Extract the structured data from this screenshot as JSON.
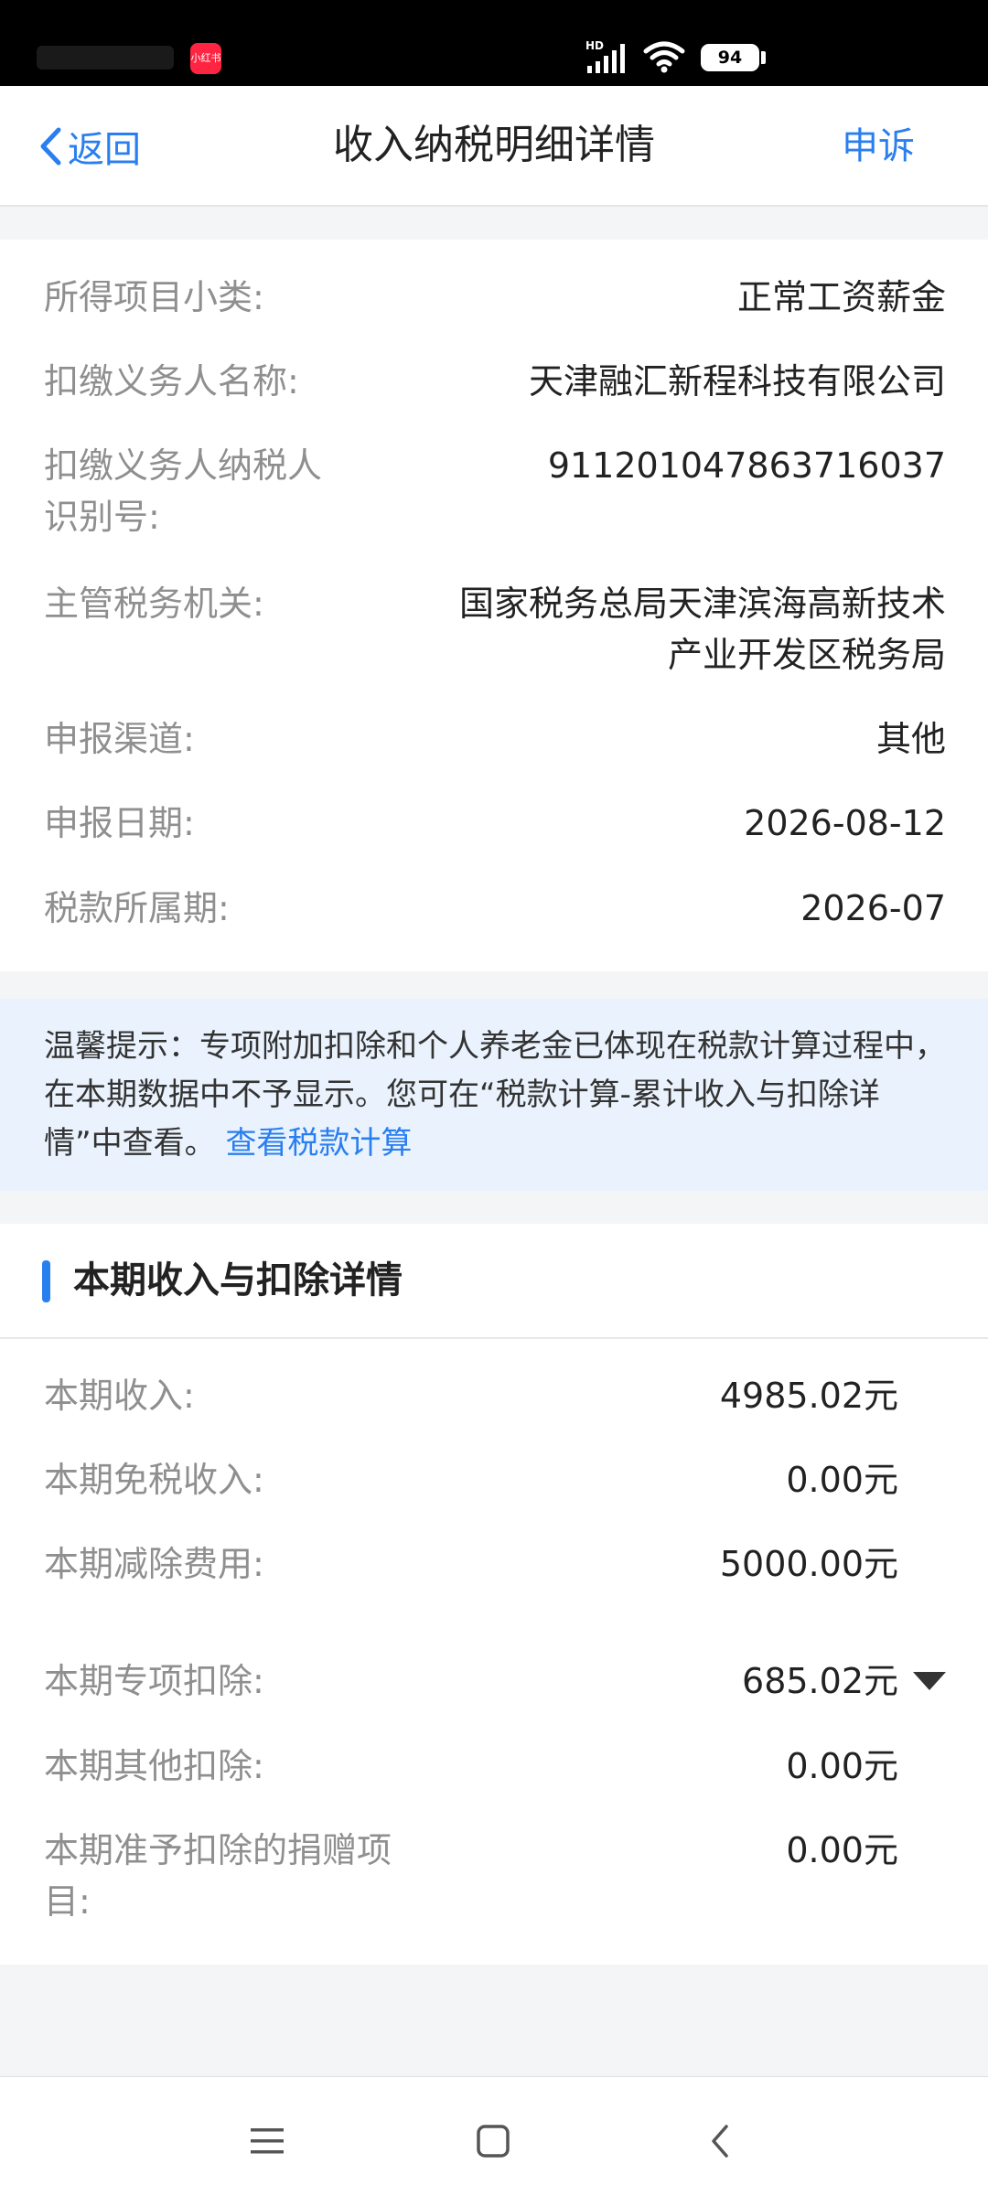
{
  "status_bar": {
    "app_badge": "小红书",
    "network": "HD",
    "battery": "94"
  },
  "header": {
    "back_label": "返回",
    "title": "收入纳税明细详情",
    "appeal_label": "申诉"
  },
  "details": [
    {
      "label": "所得项目小类:",
      "value": "正常工资薪金"
    },
    {
      "label": "扣缴义务人名称:",
      "value": "天津融汇新程科技有限公司"
    },
    {
      "label": "扣缴义务人纳税人",
      "label2": "识别号:",
      "value": "911201047863716037"
    },
    {
      "label": "主管税务机关:",
      "value": "国家税务总局天津滨海高新技术",
      "value2": "产业开发区税务局"
    },
    {
      "label": "申报渠道:",
      "value": "其他"
    },
    {
      "label": "申报日期:",
      "value": "2026-08-12"
    },
    {
      "label": "税款所属期:",
      "value": "2026-07"
    }
  ],
  "tip": {
    "text": "温馨提示：专项附加扣除和个人养老金已体现在税款计算过程中，在本期数据中不予显示。您可在“税款计算-累计收入与扣除详情”中查看。",
    "link": "查看税款计算"
  },
  "income_section": {
    "title": "本期收入与扣除详情",
    "rows": [
      {
        "label": "本期收入:",
        "value": "4985.02元"
      },
      {
        "label": "本期免税收入:",
        "value": "0.00元"
      },
      {
        "label": "本期减除费用:",
        "value": "5000.00元"
      },
      {
        "label": "本期专项扣除:",
        "value": "685.02元"
      },
      {
        "label": "本期其他扣除:",
        "value": "0.00元"
      },
      {
        "label": "本期准予扣除的捐赠项",
        "label2": "目:",
        "value": "0.00元"
      }
    ]
  },
  "nav": {
    "menu_icon": "menu-icon",
    "home_icon": "home-icon",
    "back_icon": "back-icon"
  }
}
